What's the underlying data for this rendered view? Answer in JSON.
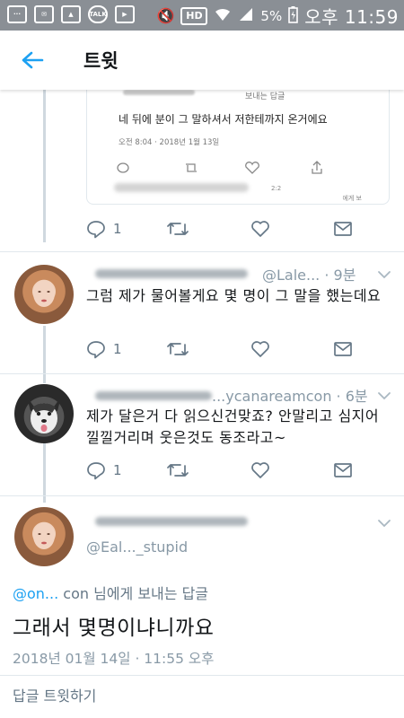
{
  "status_bar": {
    "battery_percent": "5%",
    "time": "오후 11:59",
    "icons": [
      "chat-icon",
      "mail-icon",
      "gallery-icon",
      "talk-icon",
      "media-icon",
      "mute-icon",
      "hd-icon",
      "wifi-icon",
      "signal-icon",
      "battery-icon"
    ],
    "talk_label": "TALK",
    "hd_label": "HD"
  },
  "header": {
    "title": "트윗",
    "back_icon": "arrow-left-icon"
  },
  "quoted_image": {
    "reply_note": "보내는 답글",
    "text": "네 뒤에 분이 그 말하셔서 저한테까지 온거에요",
    "date": "오전 8:04 · 2018년 1월 13일",
    "bottom_note": "2:2",
    "bottom_note2": "에게 보"
  },
  "tweets": [
    {
      "handle": "@Lale... · 9분",
      "text": "그럼 제가 물어볼게요 몇 명이 그 말을 했는데요",
      "replies": "1"
    },
    {
      "handle": "...ycanareamcon · 6분",
      "text_line1": "제가 달은거 다 읽으신건맞죠? 안말리고 심지어",
      "text_line2": "낄낄거리며 웃은것도 동조라고~",
      "replies": "1"
    }
  ],
  "first_actions": {
    "replies": "1"
  },
  "main_tweet": {
    "handle": "@Eal..._stupid",
    "reply_to_handle": "@on...",
    "reply_to_suffix": "con 님에게 보내는 답글",
    "text": "그래서 몇명이냐니까요",
    "datetime": "2018년 01월 14일 · 11:55 오후"
  },
  "reply_bar": {
    "placeholder": "답글 트윗하기"
  },
  "colors": {
    "accent": "#1da1f2",
    "muted": "#657786",
    "status_bar": "#8a8f95"
  }
}
